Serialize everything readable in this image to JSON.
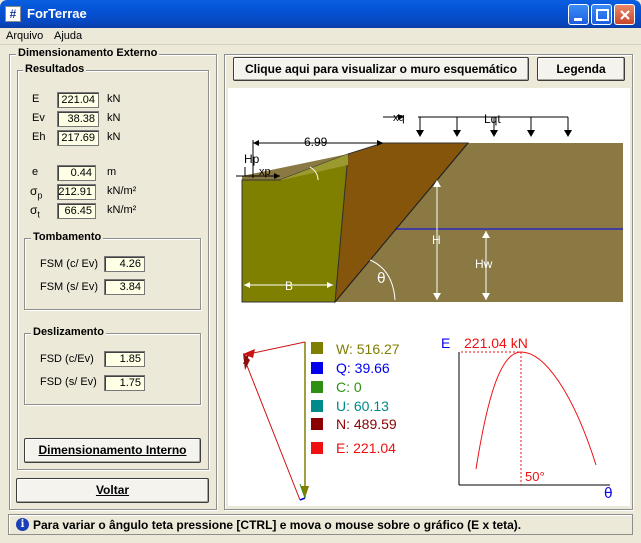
{
  "window": {
    "title": "ForTerrae",
    "app_icon": "#"
  },
  "menu": {
    "items": [
      "Arquivo",
      "Ajuda"
    ]
  },
  "left_panel": {
    "title": "Dimensionamento Externo",
    "resultados": {
      "title": "Resultados",
      "E": {
        "label": "E",
        "value": "221.04",
        "unit": "kN"
      },
      "Ev": {
        "label": "Ev",
        "value": "38.38",
        "unit": "kN"
      },
      "Eh": {
        "label": "Eh",
        "value": "217.69",
        "unit": "kN"
      },
      "e": {
        "label": "e",
        "value": "0.44",
        "unit": "m"
      },
      "sp": {
        "label": "σ",
        "sub": "p",
        "value": "212.91",
        "unit": "kN/m²"
      },
      "st": {
        "label": "σ",
        "sub": "t",
        "value": "66.45",
        "unit": "kN/m²"
      }
    },
    "tombamento": {
      "title": "Tombamento",
      "fsm_cev": {
        "label": "FSM (c/ Ev)",
        "value": "4.26"
      },
      "fsm_sev": {
        "label": "FSM (s/ Ev)",
        "value": "3.84"
      }
    },
    "deslizamento": {
      "title": "Deslizamento",
      "fsd_cev": {
        "label": "FSD (c/Ev)",
        "value": "1.85"
      },
      "fsd_sev": {
        "label": "FSD (s/ Ev)",
        "value": "1.75"
      }
    },
    "dim_interno_label": "Dimensionamento Interno",
    "voltar_label": "Voltar"
  },
  "right_panel": {
    "view_button_label": "Clique aqui para visualizar o muro esquemático",
    "legend_button_label": "Legenda",
    "diagram": {
      "xq": "xq",
      "lqt": "Lqt",
      "dim_width": "6.99",
      "hp": "Hp",
      "xp": "xp",
      "h": "H",
      "hw": "Hw",
      "b": "B",
      "theta": "θ"
    },
    "forces": [
      {
        "label": "W: 516.27",
        "color": "#7e7e00"
      },
      {
        "label": "Q: 39.66",
        "color": "#0000ee"
      },
      {
        "label": "C: 0",
        "color": "#2e8f12"
      },
      {
        "label": "U: 60.13",
        "color": "#008b8b"
      },
      {
        "label": "N: 489.59",
        "color": "#8b0000"
      },
      {
        "label": "E: 221.04",
        "color": "#ee1111"
      }
    ],
    "chart": {
      "y_axis_label": "E",
      "x_axis_label": "θ",
      "peak_label": "221.04 kN",
      "angle_label": "50°"
    }
  },
  "status": {
    "text": "Para variar o ângulo teta pressione [CTRL] e mova o mouse sobre o gráfico (E x teta)."
  },
  "colors": {
    "wall": "#808000",
    "soil": "#8a7942",
    "wedge": "#84550a",
    "water_line": "#0000ff",
    "chart_curve": "#ee1111",
    "diagram_bg": "#ffffff"
  }
}
